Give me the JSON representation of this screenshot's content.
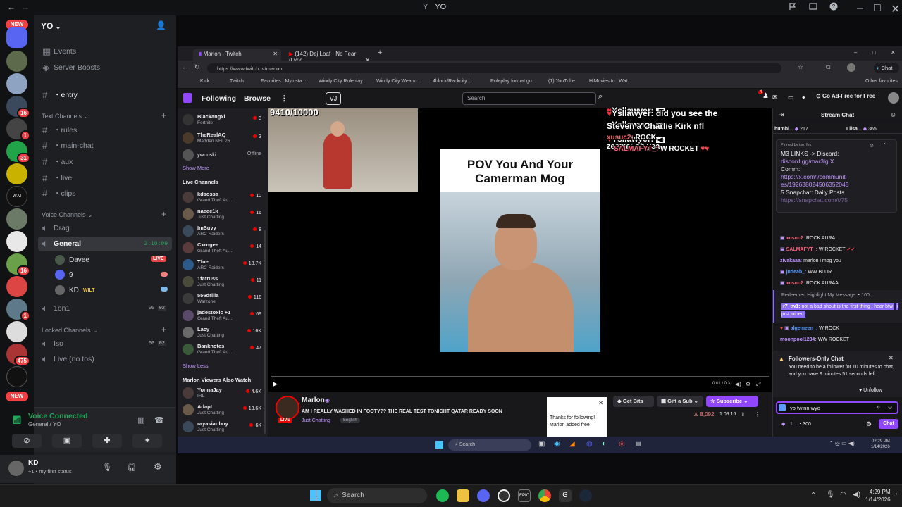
{
  "titlebar": {
    "title": "YO"
  },
  "server_rail": {
    "new_label": "NEW",
    "new_label_bottom": "NEW",
    "badges": [
      "16",
      "1",
      "31",
      "16",
      "1",
      "475"
    ]
  },
  "server": {
    "name": "YO",
    "events": "Events",
    "boosts": "Server Boosts",
    "entry": "・entry",
    "text_category": "Text Channels",
    "text_channels": [
      "・rules",
      "・main-chat",
      "・aux",
      "・live",
      "・clips"
    ],
    "voice_category": "Voice Channels",
    "voice_channels": [
      "Drag",
      "General",
      "1on1"
    ],
    "general_timer": "2:10:09",
    "voice_users": [
      {
        "name": "Davee",
        "live": "LIVE"
      },
      {
        "name": "9"
      },
      {
        "name": "KD",
        "tag": "WILT"
      }
    ],
    "oneonone_counts": [
      "00",
      "02"
    ],
    "locked_category": "Locked Channels",
    "locked_channels": [
      "Iso",
      "Live (no tos)"
    ],
    "iso_counts": [
      "00",
      "02"
    ]
  },
  "voice_panel": {
    "status": "Voice Connected",
    "location": "General / YO"
  },
  "user_panel": {
    "name": "KD",
    "status": "+1 • my first status"
  },
  "browser": {
    "tabs": [
      "Marlon - Twitch",
      "(142) Dej Loaf - No Fear (Lyric"
    ],
    "url": "https://www.twitch.tv/marlon",
    "bookmarks": [
      "Kick",
      "Twitch",
      "Favorites | Myinsta...",
      "Windy City Roleplay",
      "Windy City Weapo...",
      "4block/Rackcity |...",
      "Roleplay format gu...",
      "(1) YouTube",
      "HiMovies.to | Wat..."
    ],
    "other_favorites": "Other favorites",
    "chat_button": "Chat"
  },
  "twitch": {
    "following": "Following",
    "browse": "Browse",
    "search_placeholder": "Search",
    "adfree": "Go Ad-Free for Free",
    "notif_count": "4",
    "followed": [
      {
        "name": "Blackangxl",
        "game": "Fortnite",
        "viewers": "3"
      },
      {
        "name": "TheRealAQ_",
        "game": "Madden NFL 26",
        "viewers": "3"
      },
      {
        "name": "ywooski",
        "game": "",
        "viewers": "Offline"
      }
    ],
    "show_more": "Show More",
    "live_channels_title": "Live Channels",
    "live_channels": [
      {
        "name": "kdsossa",
        "game": "Grand Theft Au...",
        "viewers": "10"
      },
      {
        "name": "naeee1k_",
        "game": "Just Chatting",
        "viewers": "16"
      },
      {
        "name": "ImSuvy",
        "game": "ARC Raiders",
        "viewers": "8"
      },
      {
        "name": "Cxrngee",
        "game": "Grand Theft Au...",
        "viewers": "14"
      },
      {
        "name": "Tfue",
        "game": "ARC Raiders",
        "viewers": "18.7K"
      },
      {
        "name": "1fatruss",
        "game": "Just Chatting",
        "viewers": "11"
      },
      {
        "name": "556drilla",
        "game": "Warzone",
        "viewers": "116"
      },
      {
        "name": "jadestoxic +1",
        "game": "Grand Theft Au...",
        "viewers": "69"
      },
      {
        "name": "Lacy",
        "game": "Just Chatting",
        "viewers": "16K"
      },
      {
        "name": "Banknotes",
        "game": "Grand Theft Au...",
        "viewers": "47"
      }
    ],
    "show_less": "Show Less",
    "also_watch_title": "Marlon Viewers Also Watch",
    "also_watch": [
      {
        "name": "YonnaJay",
        "game": "IRL",
        "viewers": "4.6K"
      },
      {
        "name": "Adapt",
        "game": "Just Chatting",
        "viewers": "13.6K"
      },
      {
        "name": "rayasianboy",
        "game": "Just Chatting",
        "viewers": "6K"
      }
    ]
  },
  "video": {
    "goal": "9410/10000",
    "clip_title_1": "POV You And Your",
    "clip_title_2": "Camerman Mog",
    "time": "0:01 / 0:31",
    "overlay_chat": [
      {
        "user": "Ysllawyer:",
        "text": ""
      },
      {
        "user": "Ysllawyer:",
        "text": ""
      },
      {
        "user": "Ysllawyer:",
        "text": ""
      },
      {
        "user": "Ysllawyer:",
        "text": "did you see the"
      },
      {
        "user": "",
        "text": "Steven a Charlie Kirk nfl"
      },
      {
        "user": "zeema:",
        "text": "oh yea"
      },
      {
        "user": "xusuc2:",
        "text": "ROCK"
      },
      {
        "user": "SALMAFYT_:",
        "text": "W ROCKET"
      }
    ]
  },
  "stream": {
    "name": "Marlon",
    "title": "AM I REALLY WASHED IN FOOTY?? THE REAL TEST TONIGHT QATAR READY SOON",
    "category": "Just Chatting",
    "tag": "English",
    "live": "LIVE",
    "viewers": "8,092",
    "uptime": "1:09:16",
    "get_bits": "Get Bits",
    "gift_sub": "Gift a Sub",
    "subscribe": "Subscribe",
    "toast_1": "Thanks for following!",
    "toast_2": "Marlon added free"
  },
  "chat": {
    "header": "Stream Chat",
    "top_users": [
      {
        "name": "humbl...",
        "amount": "217"
      },
      {
        "name": "Lilsa...",
        "amount": "365"
      }
    ],
    "pinned_by": "Pinned by iso_fex",
    "pinned_lines": [
      "M3 LINKS -> Discord:",
      "discord.gg/mar3lg X",
      "Comm:",
      "https://x.com/i/communiti",
      "es/192638024506352045",
      "5 Snapchat: Daily Posts",
      "https://snapchat.com/t/75"
    ],
    "messages": [
      {
        "user": "xusuc2:",
        "text": "ROCK AURA"
      },
      {
        "user": "SALMAFYT_:",
        "text": "W ROCKET"
      },
      {
        "user": "zivakaaa:",
        "text": "marlon i mog you"
      },
      {
        "user": "judeab_:",
        "text": "WW BLUR"
      },
      {
        "user": "xusuc2:",
        "text": "ROCK AURAA"
      }
    ],
    "highlight_label": "Redeemed Highlight My Message",
    "highlight_cost": "100",
    "highlight_user": "r7_tw1:",
    "highlight_text": "not a bad shout is the first thing i hear btw",
    "highlight_text2": "i just joined",
    "messages2": [
      {
        "user": "algemeen_:",
        "text": "W ROCK"
      },
      {
        "user": "moonpool1234:",
        "text": "WW ROCKET"
      }
    ],
    "followers_title": "Followers-Only Chat",
    "followers_text": "You need to be a follower for 10 minutes to chat, and you have 9 minutes 51 seconds left.",
    "unfollow": "Unfollow",
    "input_value": "yo twinn wyo",
    "points": "300",
    "points_small": "1",
    "chat_button": "Chat"
  },
  "inner_taskbar": {
    "search": "Search",
    "time": "02:29 PM",
    "date": "1/14/2026"
  },
  "taskbar": {
    "search": "Search",
    "time": "4:29 PM",
    "date": "1/14/2026"
  }
}
